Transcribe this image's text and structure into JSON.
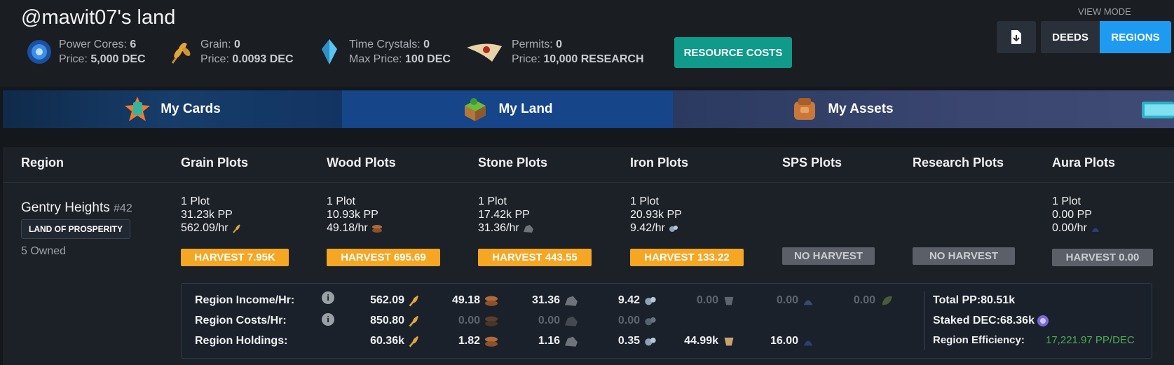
{
  "header": {
    "title": "@mawit07's land",
    "resources": [
      {
        "name": "Power Cores: ",
        "value": "6",
        "price_label": "Price: ",
        "price": "5,000 DEC",
        "icon": "power-core-icon"
      },
      {
        "name": "Grain: ",
        "value": "0",
        "price_label": "Price: ",
        "price": "0.0093 DEC",
        "icon": "grain-icon"
      },
      {
        "name": "Time Crystals: ",
        "value": "0",
        "price_label": "Max Price: ",
        "price": "100 DEC",
        "icon": "time-crystal-icon"
      },
      {
        "name": "Permits: ",
        "value": "0",
        "price_label": "Price: ",
        "price": "10,000 RESEARCH",
        "icon": "permit-icon"
      }
    ],
    "resource_costs_label": "RESOURCE COSTS",
    "view_mode_label": "VIEW MODE",
    "deeds_label": "DEEDS",
    "regions_label": "REGIONS"
  },
  "tabs": [
    {
      "label": "My Cards"
    },
    {
      "label": "My Land"
    },
    {
      "label": "My Assets"
    }
  ],
  "table": {
    "headers": [
      "Region",
      "Grain Plots",
      "Wood Plots",
      "Stone Plots",
      "Iron Plots",
      "SPS Plots",
      "Research Plots",
      "Aura Plots"
    ],
    "region": {
      "name": "Gentry Heights",
      "number": "#42",
      "badge": "LAND OF PROSPERITY",
      "owned": "5 Owned"
    },
    "plots": [
      {
        "count": "1 Plot",
        "pp": "31.23k PP",
        "rate": "562.09/hr",
        "harvest": "HARVEST 7.95K"
      },
      {
        "count": "1 Plot",
        "pp": "10.93k PP",
        "rate": "49.18/hr",
        "harvest": "HARVEST 695.69"
      },
      {
        "count": "1 Plot",
        "pp": "17.42k PP",
        "rate": "31.36/hr",
        "harvest": "HARVEST 443.55"
      },
      {
        "count": "1 Plot",
        "pp": "20.93k PP",
        "rate": "9.42/hr",
        "harvest": "HARVEST 133.22"
      },
      {
        "harvest": "NO HARVEST"
      },
      {
        "harvest": "NO HARVEST"
      },
      {
        "count": "1 Plot",
        "pp": "0.00 PP",
        "rate": "0.00/hr",
        "harvest": "HARVEST 0.00"
      }
    ]
  },
  "summary": {
    "income_label": "Region Income/Hr:",
    "costs_label": "Region Costs/Hr:",
    "holdings_label": "Region Holdings:",
    "income": [
      "562.09",
      "49.18",
      "31.36",
      "9.42",
      "0.00",
      "0.00",
      "0.00"
    ],
    "costs": [
      "850.80",
      "0.00",
      "0.00",
      "0.00"
    ],
    "holdings": [
      "60.36k",
      "1.82",
      "1.16",
      "0.35",
      "44.99k",
      "16.00"
    ],
    "total_pp": "Total PP:80.51k",
    "staked_dec": "Staked DEC:68.36k",
    "efficiency_label": "Region Efficiency:",
    "efficiency": "17,221.97 PP/DEC"
  },
  "colors": {
    "teal": "#0f9a8a",
    "accent_blue": "#1e9bf0",
    "harvest_orange": "#f5a623",
    "efficiency_green": "#4caf50"
  }
}
